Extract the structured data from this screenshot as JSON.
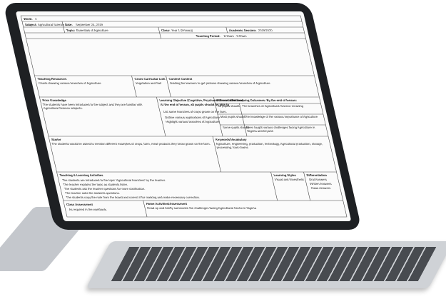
{
  "lesson": {
    "week_label": "Week:",
    "week_value": "2",
    "date_label": "Date:",
    "date_value": "September 24, 2019",
    "subject_label": "Subject:",
    "subject_value": "Agricultural Science",
    "topic_label": "Topic:",
    "topic_value": "Essentials of Agriculture",
    "class_label": "Class:",
    "class_value": "Year 1 (Primary)",
    "session_label": "Academic Session:",
    "session_value": "2019/2020",
    "period_label": "Teaching Period:",
    "period_value": "8:15am - 9:00am"
  },
  "sections": {
    "resources_title": "Teaching Resources",
    "resources_text": "Charts showing various branches of Agriculture",
    "cross_title": "Cross Curricular Link",
    "cross_text": "Vegetation and Soil",
    "content_title": "Content Context",
    "content_text": "Guiding the learners to get pictures showing various branches of Agriculture",
    "prior_title": "Prior Knowledge",
    "prior_text": "The students have been introduced to the subject and they are familiar with Agricultural Science subjects.",
    "objectives_title": "Learning Objective (Cognitive, Psychomotor and Affective)",
    "objectives_sub": "At the end of lesson, all pupils should be able to",
    "objectives_items": [
      "List some branches of crops grown on the farm.",
      "Outline various applications of Agriculture",
      "Highlight various branches of Agriculture"
    ],
    "outcomes_title": "Differentiated Learning Outcomes: By the end of lesson:",
    "outcomes_rows": [
      {
        "who": "All pupils should",
        "what": "The branches of Agricultural Science meaning"
      },
      {
        "who": "Most pupils should",
        "what": "The knowledge of the various importance of Agriculture"
      },
      {
        "who": "Some pupils should",
        "what": "Been taught various challenges facing Agriculture in Nigeria and beyond"
      }
    ],
    "starter_title": "Starter",
    "starter_text": "The students would be asked to mention different examples of crops, farm, meat products they know grown on the farm.",
    "keywords_title": "Keywords/Vocabulary",
    "keywords_text": "Agriculture, engineering, production, technology, Agricultural production, storage, processing, food chains",
    "activities_title": "Teaching & Learning Activities",
    "activities_items": [
      "The students are introduced to the topic 'Agricultural branches' by the teacher.",
      "The teacher explains the topic as students listen.",
      "The students ask the teacher questions for more clarification.",
      "The teacher asks the students questions.",
      "The students copy the note from the board and correct it for marking and make necessary correction."
    ],
    "styles_title": "Learning Styles",
    "styles_text": "Visual and Kinesthetic",
    "diff_title": "Differentiation",
    "diff_items": [
      "Oral Answers",
      "Written Answers",
      "Class Answers"
    ],
    "assessment_title": "Class Assessment",
    "assessment_text": "As required in the workbook.",
    "home_title": "Home Activities/Assessment",
    "home_text": "Read up and briefly summarize the challenges facing Agricultural Sector in Nigeria"
  }
}
